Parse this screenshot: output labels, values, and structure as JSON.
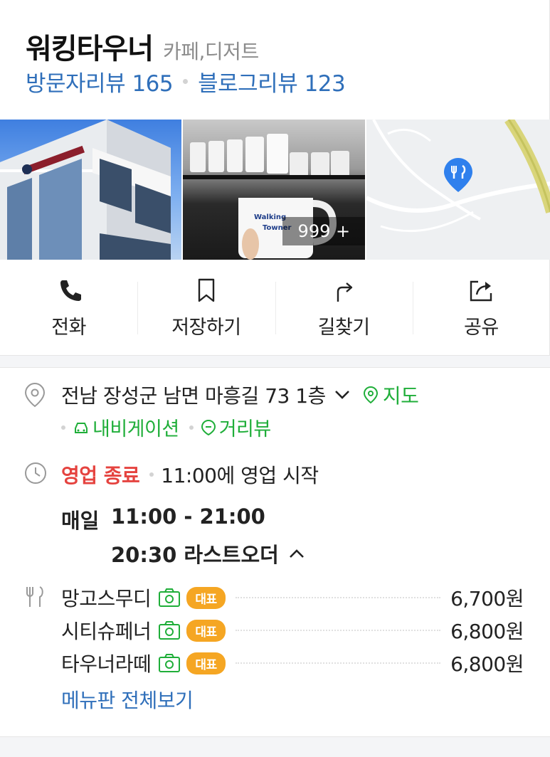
{
  "place": {
    "name": "워킹타우너",
    "category": "카페,디저트",
    "visitor_review": "방문자리뷰 165",
    "blog_review": "블로그리뷰 123"
  },
  "photos": {
    "count_label": "999 +"
  },
  "actions": [
    {
      "label": "전화",
      "icon": "phone-icon"
    },
    {
      "label": "저장하기",
      "icon": "bookmark-icon"
    },
    {
      "label": "길찾기",
      "icon": "directions-icon"
    },
    {
      "label": "공유",
      "icon": "share-icon"
    }
  ],
  "address": {
    "text": "전남 장성군 남면 마흥길 73 1층",
    "map_link": "지도",
    "navigation_link": "내비게이션",
    "street_view_link": "거리뷰"
  },
  "hours": {
    "status": "영업 종료",
    "next_open": "11:00에 영업 시작",
    "day": "매일",
    "range": "11:00 - 21:00",
    "last_order": "20:30 라스트오더"
  },
  "menu": {
    "items": [
      {
        "name": "망고스무디",
        "badge": "대표",
        "price": "6,700원"
      },
      {
        "name": "시티슈페너",
        "badge": "대표",
        "price": "6,800원"
      },
      {
        "name": "타우너라떼",
        "badge": "대표",
        "price": "6,800원"
      }
    ],
    "view_all": "메뉴판 전체보기"
  },
  "colors": {
    "link_blue": "#2f6fba",
    "green": "#1fae39",
    "closed_red": "#e5433f",
    "badge_orange": "#f5a623",
    "map_pin_blue": "#2f80ed"
  }
}
